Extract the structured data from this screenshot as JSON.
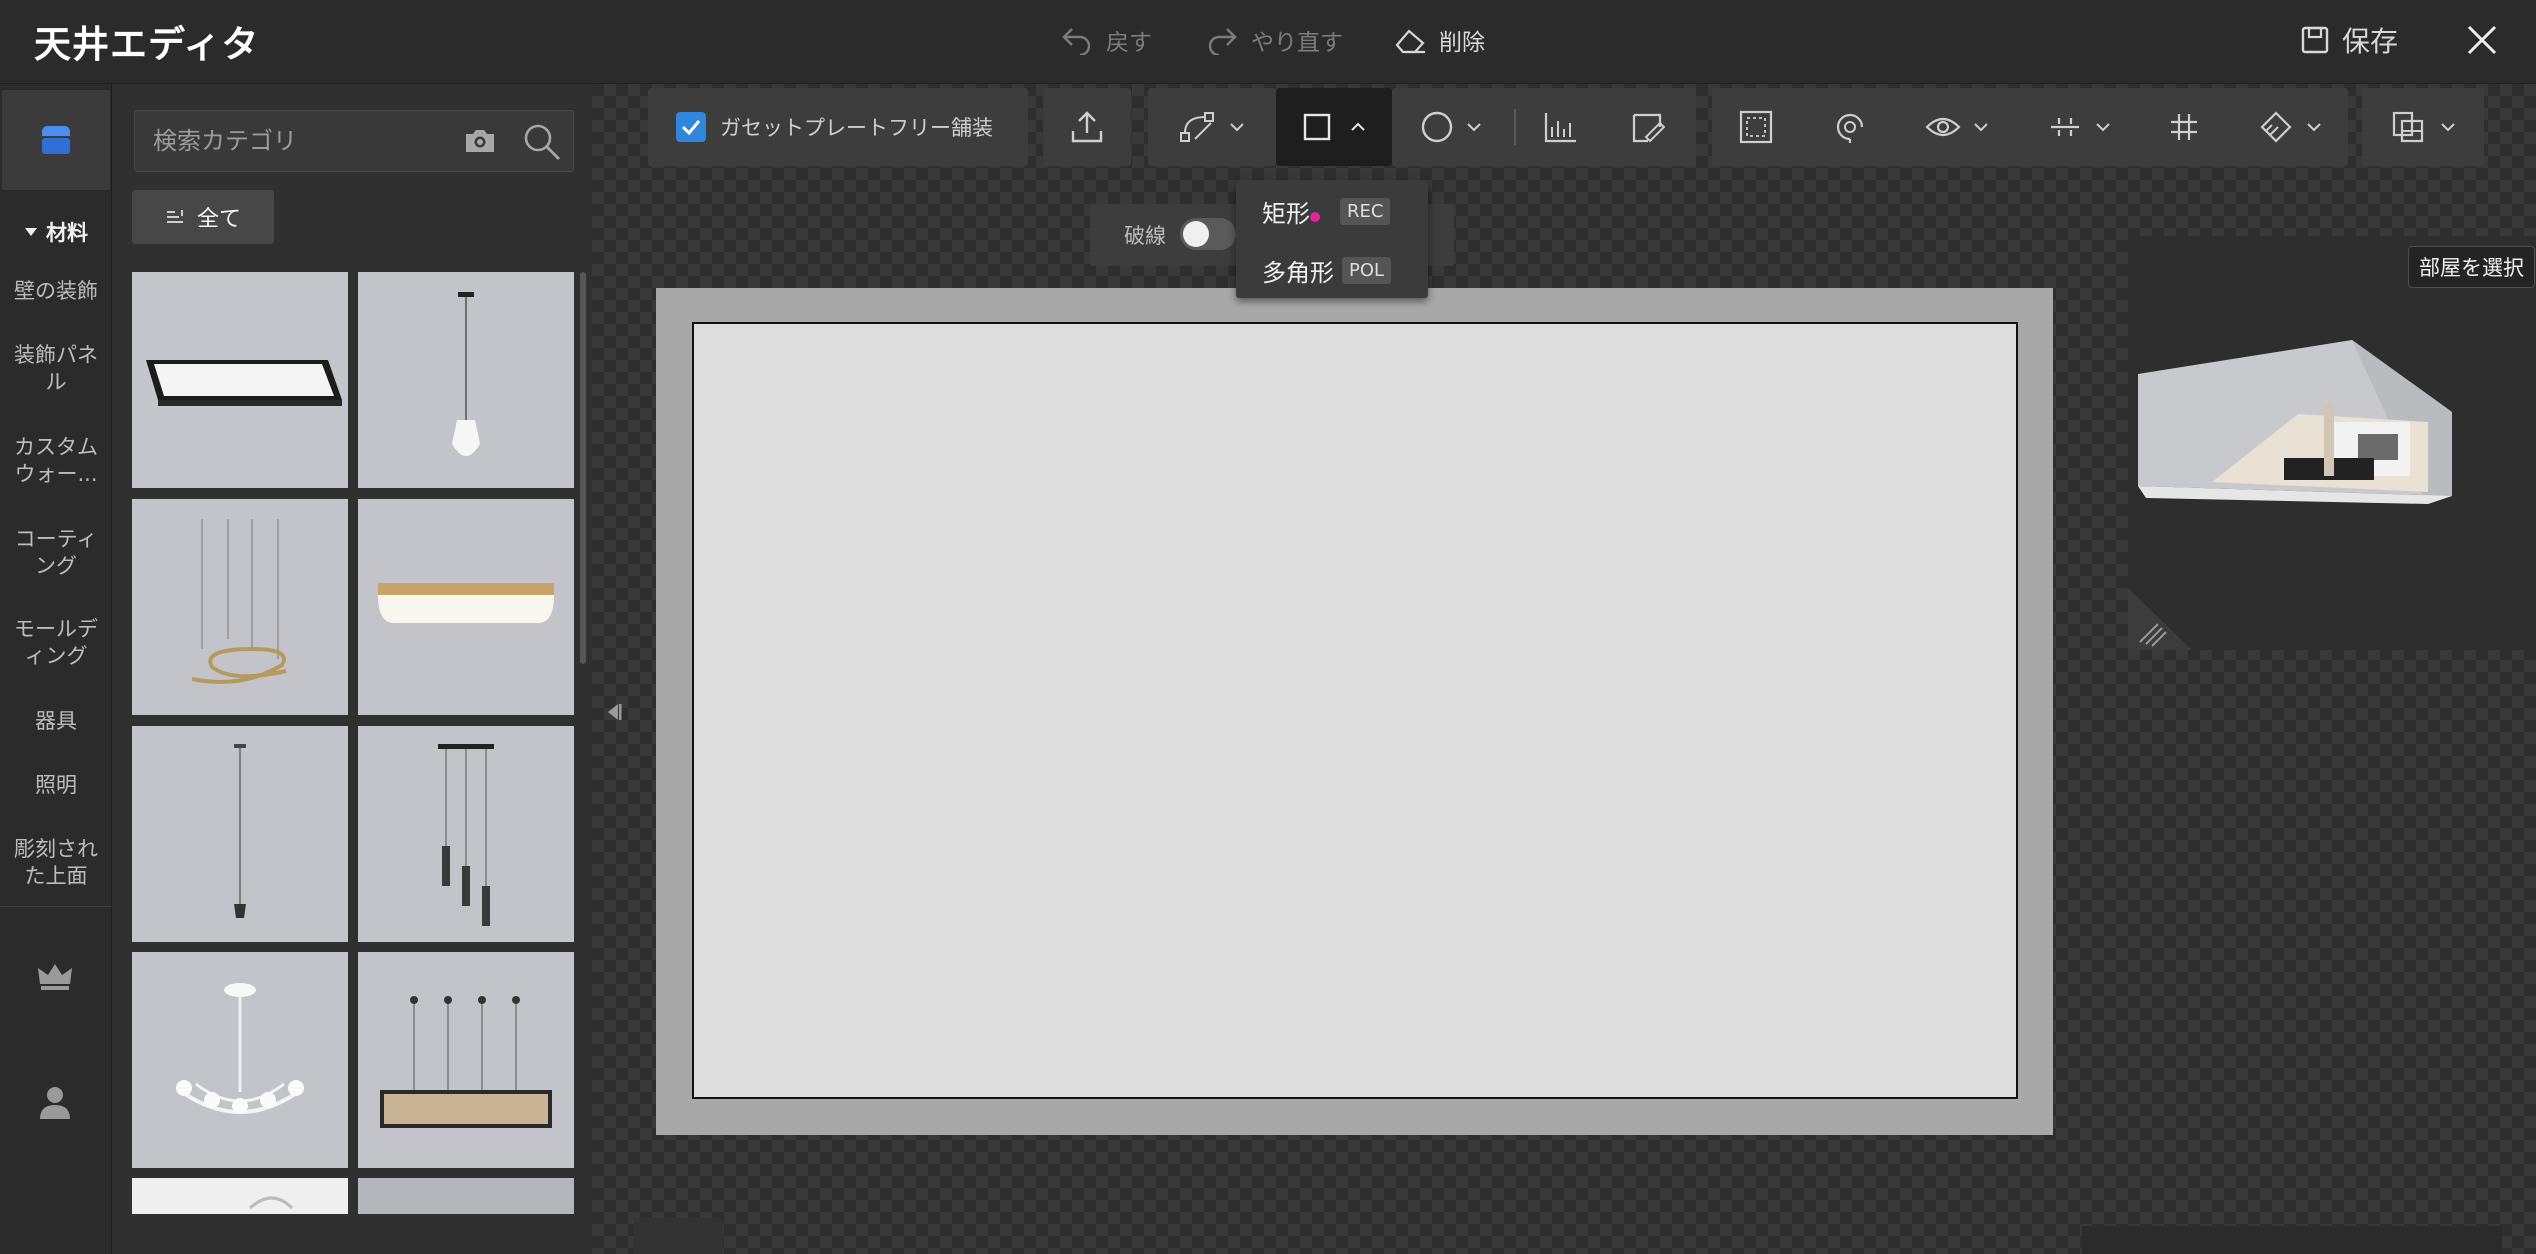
{
  "app": {
    "title": "天井エディタ"
  },
  "titlebar": {
    "undo_label": "戻す",
    "redo_label": "やり直す",
    "delete_label": "削除",
    "save_label": "保存"
  },
  "rail": {
    "category_header": "材料",
    "categories": [
      {
        "label": "壁の装飾"
      },
      {
        "label": "装飾パネル"
      },
      {
        "label": "カスタムウォー..."
      },
      {
        "label": "コーティング"
      },
      {
        "label": "モールディング"
      },
      {
        "label": "器具"
      },
      {
        "label": "照明"
      },
      {
        "label": "彫刻された上面"
      }
    ]
  },
  "catalog": {
    "search": {
      "placeholder": "検索カテゴリ",
      "value": ""
    },
    "filter_label": "全て",
    "items": [
      {
        "name": "square-panel-light"
      },
      {
        "name": "cone-pendant-light"
      },
      {
        "name": "spiral-pendant-light"
      },
      {
        "name": "gold-frame-ceiling-light"
      },
      {
        "name": "single-pendant-light"
      },
      {
        "name": "triple-tube-pendant"
      },
      {
        "name": "chandelier"
      },
      {
        "name": "linear-pendant-fixture"
      }
    ]
  },
  "toolbar": {
    "gasket_checkbox": {
      "label": "ガセットプレートフリー舗装",
      "checked": true
    }
  },
  "subtoolbar": {
    "dashed_label": "破線",
    "dashed_on": false
  },
  "shape_menu": {
    "items": [
      {
        "label": "矩形",
        "key": "REC"
      },
      {
        "label": "多角形",
        "key": "POL"
      }
    ]
  },
  "preview": {
    "select_room_label": "部屋を選択"
  },
  "colors": {
    "accent": "#2f86dd",
    "cursor": "#e0249c",
    "canvas_frame": "#a8a8a8",
    "ceiling_fill": "#dedede"
  }
}
